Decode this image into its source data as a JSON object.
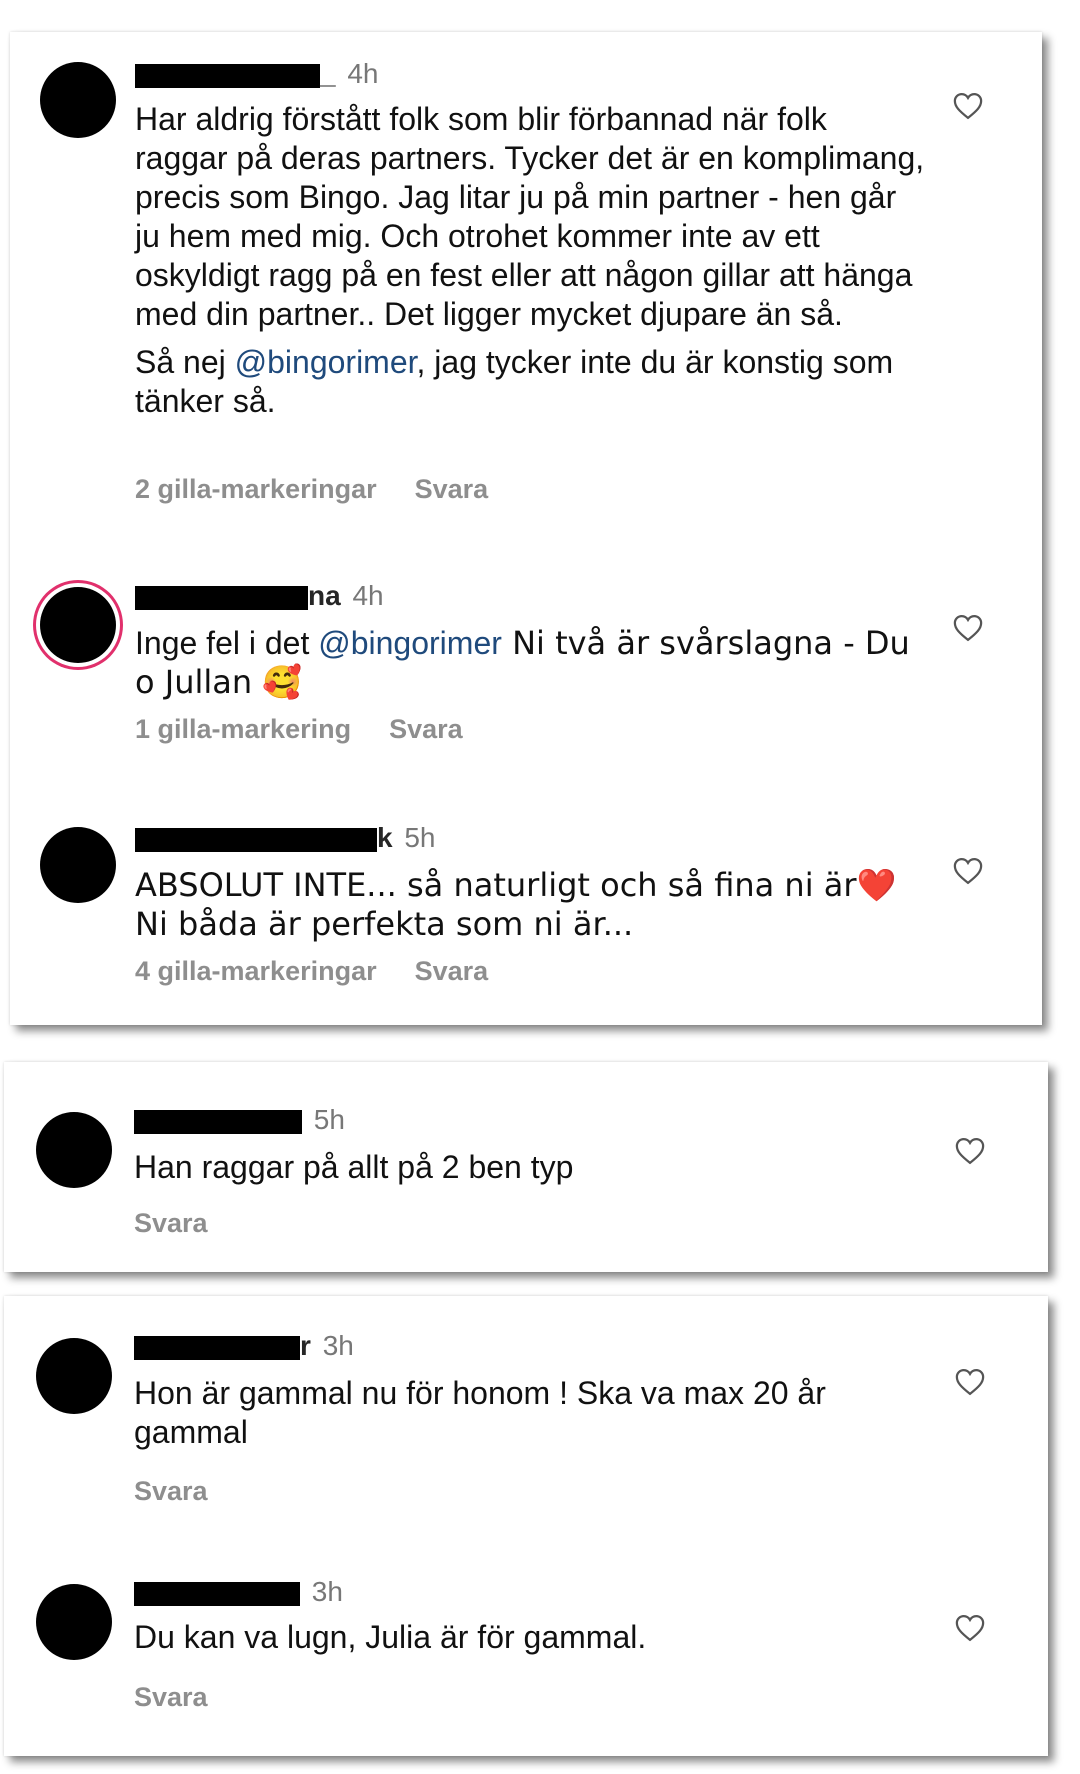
{
  "cards": [
    {
      "comments": [
        {
          "user_visible": "_",
          "time": "4h",
          "paragraphs": [
            [
              "Har aldrig förstått folk som blir förbannad när folk raggar på deras partners. Tycker det är en komplimang, precis som Bingo. Jag litar ju på min partner - hen går ju hem med mig. Och otrohet kommer inte av ett oskyldigt ragg på en fest eller att någon gillar att hänga med din partner.. Det ligger mycket djupare än så."
            ],
            [
              "Så nej ",
              "@bingorimer",
              ", jag tycker inte du är konstig som tänker så."
            ]
          ],
          "likes": "2 gilla-markeringar",
          "reply": "Svara"
        },
        {
          "user_visible": "na",
          "time": "4h",
          "paragraphs": [
            [
              "Inge fel i det ",
              "@bingorimer",
              " Ni två är svårslagna - Du o Jullan 🥰"
            ]
          ],
          "likes": "1 gilla-markering",
          "reply": "Svara"
        },
        {
          "user_visible": "k",
          "time": "5h",
          "paragraphs": [
            [
              "ABSOLUT INTE... så naturligt och så fina ni är❤️ Ni båda är perfekta som ni är..."
            ]
          ],
          "likes": "4 gilla-markeringar",
          "reply": "Svara"
        }
      ]
    },
    {
      "comments": [
        {
          "user_visible": "",
          "time": "5h",
          "paragraphs": [
            [
              "Han raggar på allt på 2 ben typ"
            ]
          ],
          "likes": "",
          "reply": "Svara"
        }
      ]
    },
    {
      "comments": [
        {
          "user_visible": "r",
          "time": "3h",
          "paragraphs": [
            [
              "Hon är gammal nu för honom ! Ska va max 20 år gammal"
            ]
          ],
          "likes": "",
          "reply": "Svara"
        },
        {
          "user_visible": "",
          "time": "3h",
          "paragraphs": [
            [
              "Du kan va lugn, Julia är för gammal."
            ]
          ],
          "likes": "",
          "reply": "Svara"
        }
      ]
    }
  ],
  "icons": {
    "like": "heart-outline-icon"
  },
  "colors": {
    "mention": "#1f4a7c",
    "meta": "#8e8e8e",
    "story_ring": "#e1306c"
  }
}
